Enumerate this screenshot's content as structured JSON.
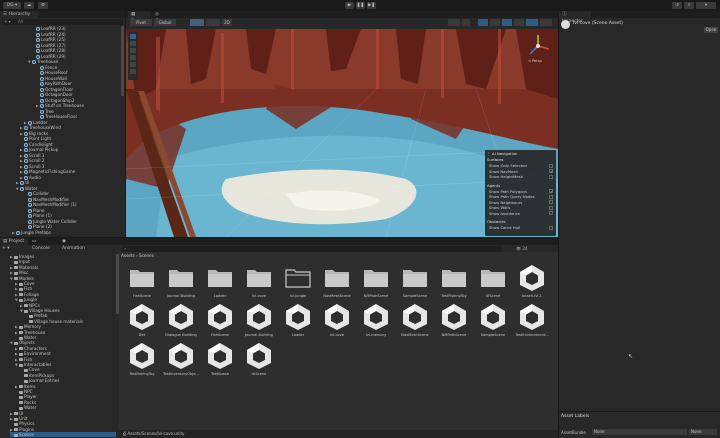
{
  "toolbar": {
    "account": "DG",
    "play": "▶",
    "pause": "❚❚",
    "step": "▶❚"
  },
  "hierarchy": {
    "title": "Hierarchy",
    "search_placeholder": "All",
    "rows": [
      {
        "label": "LeafRR (23)",
        "indent": 8,
        "arrow": ""
      },
      {
        "label": "LeafRR (24)",
        "indent": 8,
        "arrow": ""
      },
      {
        "label": "LeafRR (25)",
        "indent": 8,
        "arrow": ""
      },
      {
        "label": "LeafRR (27)",
        "indent": 8,
        "arrow": ""
      },
      {
        "label": "LeafRR (28)",
        "indent": 8,
        "arrow": ""
      },
      {
        "label": "LeafRR (29)",
        "indent": 8,
        "arrow": ""
      },
      {
        "label": "Treehouse",
        "indent": 7,
        "arrow": "▼"
      },
      {
        "label": "Fence",
        "indent": 9,
        "arrow": ""
      },
      {
        "label": "HouseRoof",
        "indent": 9,
        "arrow": ""
      },
      {
        "label": "HouseWall",
        "indent": 9,
        "arrow": ""
      },
      {
        "label": "KeyPathDoor",
        "indent": 9,
        "arrow": ""
      },
      {
        "label": "OctagonFloor",
        "indent": 9,
        "arrow": ""
      },
      {
        "label": "OctagonDoor",
        "indent": 9,
        "arrow": ""
      },
      {
        "label": "OctagonShip2",
        "indent": 9,
        "arrow": ""
      },
      {
        "label": "Stuff on Treehouse",
        "indent": 9,
        "arrow": "▶"
      },
      {
        "label": "Tree",
        "indent": 9,
        "arrow": ""
      },
      {
        "label": "TreeHouseFloor",
        "indent": 9,
        "arrow": ""
      },
      {
        "label": "Ladder",
        "indent": 6,
        "arrow": "▶"
      },
      {
        "label": "TreehouseWind",
        "indent": 5,
        "arrow": "▶"
      },
      {
        "label": "Big rocks",
        "indent": 5,
        "arrow": "▶"
      },
      {
        "label": "Point Light",
        "indent": 5,
        "arrow": ""
      },
      {
        "label": "Candlelight",
        "indent": 5,
        "arrow": ""
      },
      {
        "label": "Journal Pickup",
        "indent": 5,
        "arrow": "▶"
      },
      {
        "label": "Scroll 1",
        "indent": 5,
        "arrow": "▶"
      },
      {
        "label": "Scroll 2",
        "indent": 5,
        "arrow": "▶"
      },
      {
        "label": "Scroll 3",
        "indent": 5,
        "arrow": "▶"
      },
      {
        "label": "MagneticFishingGame",
        "indent": 5,
        "arrow": "▶"
      },
      {
        "label": "Audio",
        "indent": 5,
        "arrow": "▶"
      },
      {
        "label": "UI",
        "indent": 4,
        "arrow": "▶"
      },
      {
        "label": "Water",
        "indent": 4,
        "arrow": "▼"
      },
      {
        "label": "Collider",
        "indent": 6,
        "arrow": ""
      },
      {
        "label": "NavMeshModifier",
        "indent": 6,
        "arrow": ""
      },
      {
        "label": "NavMeshModifier (1)",
        "indent": 6,
        "arrow": ""
      },
      {
        "label": "Plane",
        "indent": 6,
        "arrow": ""
      },
      {
        "label": "Plane (1)",
        "indent": 6,
        "arrow": ""
      },
      {
        "label": "Jungle Water Collider",
        "indent": 6,
        "arrow": ""
      },
      {
        "label": "Plane (2)",
        "indent": 6,
        "arrow": ""
      },
      {
        "label": "Jungle Prefabs",
        "indent": 3,
        "arrow": "▶"
      }
    ]
  },
  "scene": {
    "tabs": [
      "Scene",
      "Game"
    ],
    "toolbar_labels": {
      "pivot": "Pivot",
      "global": "Global",
      "mode_2d": "2D"
    },
    "gizmo_label": "< Persp"
  },
  "overlay": {
    "title": "AI Navigation",
    "sections": [
      {
        "head": "Surfaces",
        "items": [
          {
            "label": "Show Only Selected",
            "checked": false
          },
          {
            "label": "Show NavMesh",
            "checked": true
          },
          {
            "label": "Show HeightMesh",
            "checked": false
          }
        ]
      },
      {
        "head": "Agents",
        "items": [
          {
            "label": "Show Path Polygons",
            "checked": true
          },
          {
            "label": "Show Path Query Nodes",
            "checked": false
          },
          {
            "label": "Show Neighbours",
            "checked": false
          },
          {
            "label": "Show Walls",
            "checked": false
          },
          {
            "label": "Show Avoidance",
            "checked": false
          }
        ]
      },
      {
        "head": "Obstacles",
        "items": [
          {
            "label": "Show Carve Hull",
            "checked": false
          }
        ]
      }
    ]
  },
  "inspector": {
    "title": "Inspector",
    "asset_name": "lvl-cove (Scene Asset)",
    "open_button": "Open",
    "labels_title": "Asset Labels",
    "assetbundle_label": "AssetBundle",
    "assetbundle_value": "None",
    "assetbundle_variant": "None"
  },
  "project": {
    "tabs": [
      "Project",
      "Console",
      "Animation"
    ],
    "breadcrumb": [
      "Assets",
      "Scenes"
    ],
    "count": "24",
    "footer_path": "Assets/Scenes/lvl-cove.unity",
    "tree": [
      {
        "label": "Images",
        "indent": 4,
        "arrow": "▶"
      },
      {
        "label": "Input",
        "indent": 4,
        "arrow": ""
      },
      {
        "label": "Materials",
        "indent": 4,
        "arrow": "▶"
      },
      {
        "label": "Misc",
        "indent": 4,
        "arrow": "▶"
      },
      {
        "label": "Models",
        "indent": 4,
        "arrow": "▼"
      },
      {
        "label": "Cove",
        "indent": 6,
        "arrow": "▶"
      },
      {
        "label": "Fish",
        "indent": 6,
        "arrow": "▶"
      },
      {
        "label": "Foliage",
        "indent": 6,
        "arrow": "▶"
      },
      {
        "label": "Jungle",
        "indent": 6,
        "arrow": "▼"
      },
      {
        "label": "NPCs",
        "indent": 8,
        "arrow": "▶"
      },
      {
        "label": "Village Houses",
        "indent": 8,
        "arrow": "▼"
      },
      {
        "label": "Prefab",
        "indent": 10,
        "arrow": ""
      },
      {
        "label": "Village house materials",
        "indent": 10,
        "arrow": ""
      },
      {
        "label": "Memory",
        "indent": 6,
        "arrow": "▶"
      },
      {
        "label": "Treehouse",
        "indent": 6,
        "arrow": "▶"
      },
      {
        "label": "Water",
        "indent": 6,
        "arrow": ""
      },
      {
        "label": "Objects",
        "indent": 4,
        "arrow": "▼"
      },
      {
        "label": "Characters",
        "indent": 6,
        "arrow": "▶"
      },
      {
        "label": "Environment",
        "indent": 6,
        "arrow": "▶"
      },
      {
        "label": "Fish",
        "indent": 6,
        "arrow": "▶"
      },
      {
        "label": "Interactables",
        "indent": 6,
        "arrow": "▼"
      },
      {
        "label": "Cove",
        "indent": 8,
        "arrow": ""
      },
      {
        "label": "ItemPickups",
        "indent": 8,
        "arrow": ""
      },
      {
        "label": "Journal Entries",
        "indent": 8,
        "arrow": ""
      },
      {
        "label": "Items",
        "indent": 6,
        "arrow": "▶"
      },
      {
        "label": "NPC",
        "indent": 6,
        "arrow": ""
      },
      {
        "label": "Player",
        "indent": 6,
        "arrow": ""
      },
      {
        "label": "Rocks",
        "indent": 6,
        "arrow": ""
      },
      {
        "label": "Water",
        "indent": 6,
        "arrow": ""
      },
      {
        "label": "UI",
        "indent": 4,
        "arrow": "▶"
      },
      {
        "label": "Unit",
        "indent": 4,
        "arrow": "▶"
      },
      {
        "label": "Physics",
        "indent": 4,
        "arrow": ""
      },
      {
        "label": "Plugins",
        "indent": 4,
        "arrow": "▶"
      },
      {
        "label": "Scenes",
        "indent": 4,
        "arrow": "",
        "selected": true
      }
    ],
    "assets": [
      {
        "label": "FishScene",
        "type": "folder"
      },
      {
        "label": "Journal Building",
        "type": "folder"
      },
      {
        "label": "Ladder",
        "type": "folder"
      },
      {
        "label": "lvl-cove",
        "type": "folder"
      },
      {
        "label": "lvl-jungle",
        "type": "folder-open"
      },
      {
        "label": "NavMeshScene",
        "type": "folder"
      },
      {
        "label": "NMPathScene",
        "type": "folder"
      },
      {
        "label": "SampleScene",
        "type": "folder"
      },
      {
        "label": "TestFishingToy",
        "type": "folder"
      },
      {
        "label": "UIScene",
        "type": "folder"
      },
      {
        "label": "beach-lvl-1",
        "type": "scene"
      },
      {
        "label": "Dirt",
        "type": "scene"
      },
      {
        "label": "Dialogue Building",
        "type": "scene"
      },
      {
        "label": "FishScene",
        "type": "scene"
      },
      {
        "label": "Journal Building",
        "type": "scene"
      },
      {
        "label": "Ladder",
        "type": "scene"
      },
      {
        "label": "lvl-cove",
        "type": "scene"
      },
      {
        "label": "lvl-memory",
        "type": "scene"
      },
      {
        "label": "NavMeshScene",
        "type": "scene"
      },
      {
        "label": "NMPathScene",
        "type": "scene"
      },
      {
        "label": "SampleScene",
        "type": "scene"
      },
      {
        "label": "TestEnvironment...",
        "type": "scene"
      },
      {
        "label": "TestFishingToy",
        "type": "scene"
      },
      {
        "label": "TestInventoryObje...",
        "type": "scene"
      },
      {
        "label": "TestSpace",
        "type": "scene"
      },
      {
        "label": "UIScene",
        "type": "scene"
      }
    ]
  },
  "colors": {
    "accent": "#2c5d87",
    "scene_red": "#7a2f22",
    "scene_blue": "#5ea8c4"
  }
}
